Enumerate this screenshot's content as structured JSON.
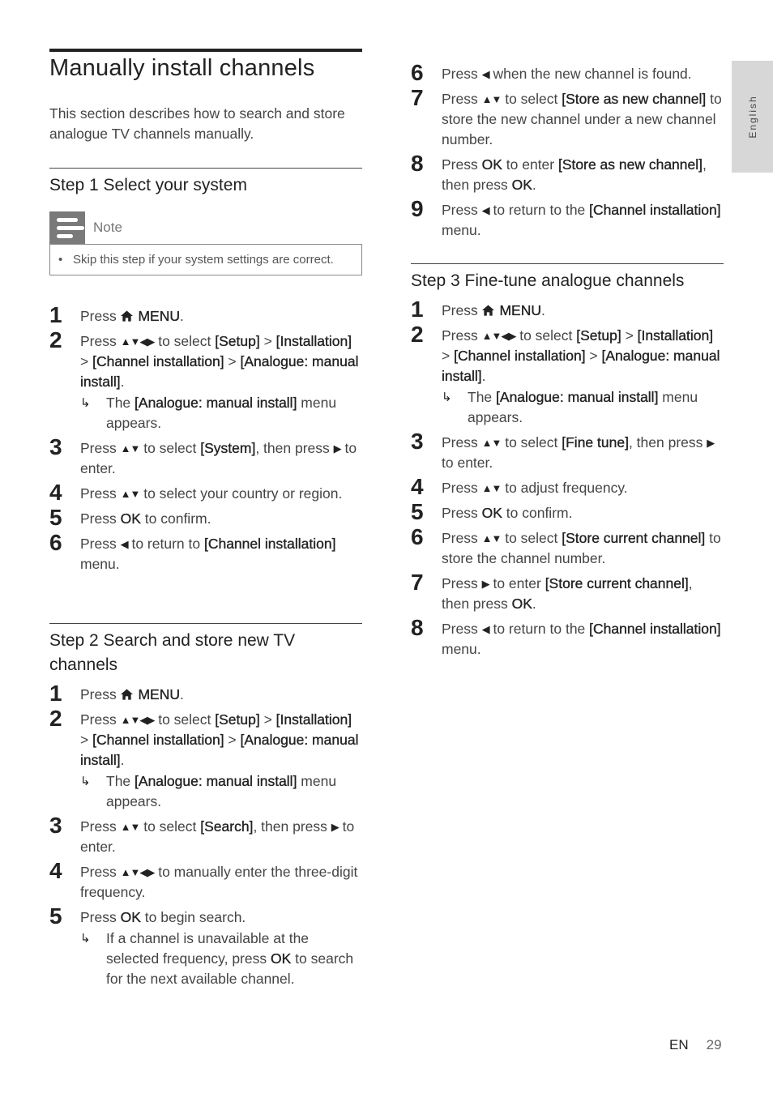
{
  "page": {
    "title": "Manually install channels",
    "intro": "This section describes how to search and store analogue TV channels manually.",
    "side_tab": "English",
    "footer": {
      "lang": "EN",
      "page_number": "29"
    }
  },
  "note": {
    "label": "Note",
    "icon": "note-icon",
    "items": [
      "Skip this step if your system settings are correct."
    ]
  },
  "step1": {
    "heading": "Step 1 Select your system",
    "steps": [
      {
        "n": "1",
        "html": "Press {home} <b>MENU</b>."
      },
      {
        "n": "2",
        "html": "Press {udlr} to select <b>[Setup]</b> &gt; <b>[Installation]</b> &gt; <b>[Channel installation]</b> &gt; <b>[Analogue: manual install]</b>.",
        "result": "The <b>[Analogue: manual install]</b> menu appears."
      },
      {
        "n": "3",
        "html": "Press {ud} to select <b>[System]</b>, then press {r} to enter."
      },
      {
        "n": "4",
        "html": "Press {ud} to select your country or region."
      },
      {
        "n": "5",
        "html": "Press <b>OK</b> to confirm."
      },
      {
        "n": "6",
        "html": "Press {l} to return to <b>[Channel installation]</b> menu."
      }
    ]
  },
  "step2": {
    "heading": "Step 2 Search and store new TV channels",
    "steps": [
      {
        "n": "1",
        "html": "Press {home} <b>MENU</b>."
      },
      {
        "n": "2",
        "html": "Press {udlr} to select <b>[Setup]</b> &gt; <b>[Installation]</b> &gt; <b>[Channel installation]</b> &gt; <b>[Analogue: manual install]</b>.",
        "result": "The <b>[Analogue: manual install]</b> menu appears."
      },
      {
        "n": "3",
        "html": "Press {ud} to select <b>[Search]</b>, then press {r} to enter."
      },
      {
        "n": "4",
        "html": "Press {udlr} to manually enter the three-digit frequency."
      },
      {
        "n": "5",
        "html": "Press <b>OK</b> to begin search.",
        "result": "If a channel is unavailable at the selected frequency, press <b>OK</b> to search for the next available channel."
      }
    ],
    "steps_cont": [
      {
        "n": "6",
        "html": "Press {l} when the new channel is found."
      },
      {
        "n": "7",
        "html": "Press {ud} to select <b>[Store as new channel]</b> to store the new channel under a new channel number."
      },
      {
        "n": "8",
        "html": "Press <b>OK</b> to enter <b>[Store as new channel]</b>, then press <b>OK</b>."
      },
      {
        "n": "9",
        "html": "Press {l} to return to the <b>[Channel installation]</b> menu."
      }
    ]
  },
  "step3": {
    "heading": "Step 3 Fine-tune analogue channels",
    "steps": [
      {
        "n": "1",
        "html": "Press {home} <b>MENU</b>."
      },
      {
        "n": "2",
        "html": "Press {udlr} to select <b>[Setup]</b> &gt; <b>[Installation]</b> &gt; <b>[Channel installation]</b> &gt; <b>[Analogue: manual install]</b>.",
        "result": "The <b>[Analogue: manual install]</b> menu appears."
      },
      {
        "n": "3",
        "html": "Press {ud} to select <b>[Fine tune]</b>, then press {r} to enter."
      },
      {
        "n": "4",
        "html": "Press {ud} to adjust frequency."
      },
      {
        "n": "5",
        "html": "Press <b>OK</b> to confirm."
      },
      {
        "n": "6",
        "html": "Press {ud} to select <b>[Store current channel]</b> to store the channel number."
      },
      {
        "n": "7",
        "html": "Press {r} to enter <b>[Store current channel]</b>, then press <b>OK</b>."
      },
      {
        "n": "8",
        "html": "Press {l} to return to the <b>[Channel installation]</b> menu."
      }
    ]
  },
  "symbols": {
    "ud": "▲▼",
    "udlr": "▲▼◀▶",
    "l": "◀",
    "r": "▶",
    "result_arrow": "↳"
  }
}
